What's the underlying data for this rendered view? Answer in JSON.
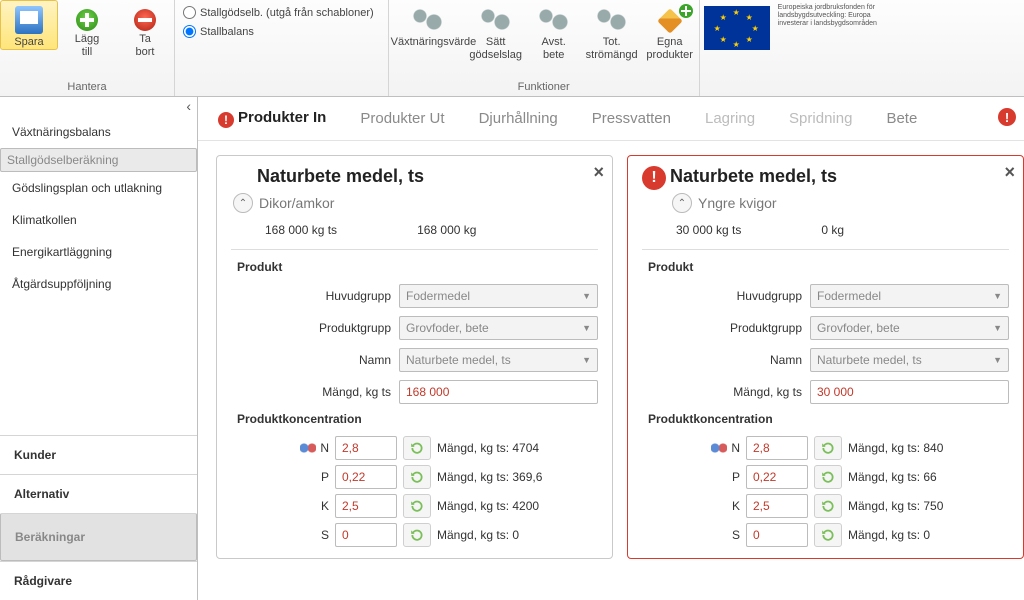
{
  "ribbon": {
    "hantera": {
      "label": "Hantera",
      "save": "Spara",
      "add": "Lägg\ntill",
      "remove": "Ta\nbort"
    },
    "radios": {
      "schablon": "Stallgödselb. (utgå från schabloner)",
      "stallbalans": "Stallbalans",
      "selected": "stallbalans"
    },
    "funktioner": {
      "label": "Funktioner",
      "vaxtnaring": "Växtnäringsvärde",
      "satt": "Sätt\ngödselslag",
      "avst": "Avst.\nbete",
      "tot": "Tot.\nströmängd",
      "egna": "Egna\nprodukter"
    },
    "eu_caption": "Europeiska jordbruksfonden för landsbygdsutveckling: Europa investerar i landsbygdsområden"
  },
  "sidebar": {
    "top": [
      "Växtnäringsbalans",
      "Stallgödselberäkning",
      "Gödslingsplan och utlakning",
      "Klimatkollen",
      "Energikartläggning",
      "Åtgärdsuppföljning"
    ],
    "top_selected_index": 1,
    "bottom": [
      "Kunder",
      "Alternativ",
      "Beräkningar",
      "Rådgivare"
    ],
    "bottom_selected_index": 2
  },
  "tabs": {
    "items": [
      {
        "label": "Produkter In",
        "error": true,
        "active": true
      },
      {
        "label": "Produkter Ut"
      },
      {
        "label": "Djurhållning"
      },
      {
        "label": "Pressvatten"
      },
      {
        "label": "Lagring",
        "disabled": true
      },
      {
        "label": "Spridning",
        "disabled": true
      },
      {
        "label": "Bete"
      }
    ],
    "trailing_error": true
  },
  "cards": [
    {
      "error": false,
      "title": "Naturbete medel, ts",
      "group": "Dikor/amkor",
      "amount_left": "168 000 kg ts",
      "amount_right": "168 000 kg",
      "section_product": "Produkt",
      "fields": {
        "huvudgrupp_label": "Huvudgrupp",
        "huvudgrupp_value": "Fodermedel",
        "produktgrupp_label": "Produktgrupp",
        "produktgrupp_value": "Grovfoder, bete",
        "namn_label": "Namn",
        "namn_value": "Naturbete medel, ts",
        "mangd_label": "Mängd, kg ts",
        "mangd_value": "168 000"
      },
      "section_conc": "Produktkoncentration",
      "conc": [
        {
          "sym": "N",
          "val": "2,8",
          "out": "Mängd, kg ts: 4704",
          "icon": true
        },
        {
          "sym": "P",
          "val": "0,22",
          "out": "Mängd, kg ts: 369,6"
        },
        {
          "sym": "K",
          "val": "2,5",
          "out": "Mängd, kg ts: 4200"
        },
        {
          "sym": "S",
          "val": "0",
          "out": "Mängd, kg ts: 0"
        }
      ]
    },
    {
      "error": true,
      "title": "Naturbete medel, ts",
      "group": "Yngre kvigor",
      "amount_left": "30 000 kg ts",
      "amount_right": "0 kg",
      "section_product": "Produkt",
      "fields": {
        "huvudgrupp_label": "Huvudgrupp",
        "huvudgrupp_value": "Fodermedel",
        "produktgrupp_label": "Produktgrupp",
        "produktgrupp_value": "Grovfoder, bete",
        "namn_label": "Namn",
        "namn_value": "Naturbete medel, ts",
        "mangd_label": "Mängd, kg ts",
        "mangd_value": "30 000"
      },
      "section_conc": "Produktkoncentration",
      "conc": [
        {
          "sym": "N",
          "val": "2,8",
          "out": "Mängd, kg ts: 840",
          "icon": true
        },
        {
          "sym": "P",
          "val": "0,22",
          "out": "Mängd, kg ts: 66"
        },
        {
          "sym": "K",
          "val": "2,5",
          "out": "Mängd, kg ts: 750"
        },
        {
          "sym": "S",
          "val": "0",
          "out": "Mängd, kg ts: 0"
        }
      ]
    }
  ]
}
